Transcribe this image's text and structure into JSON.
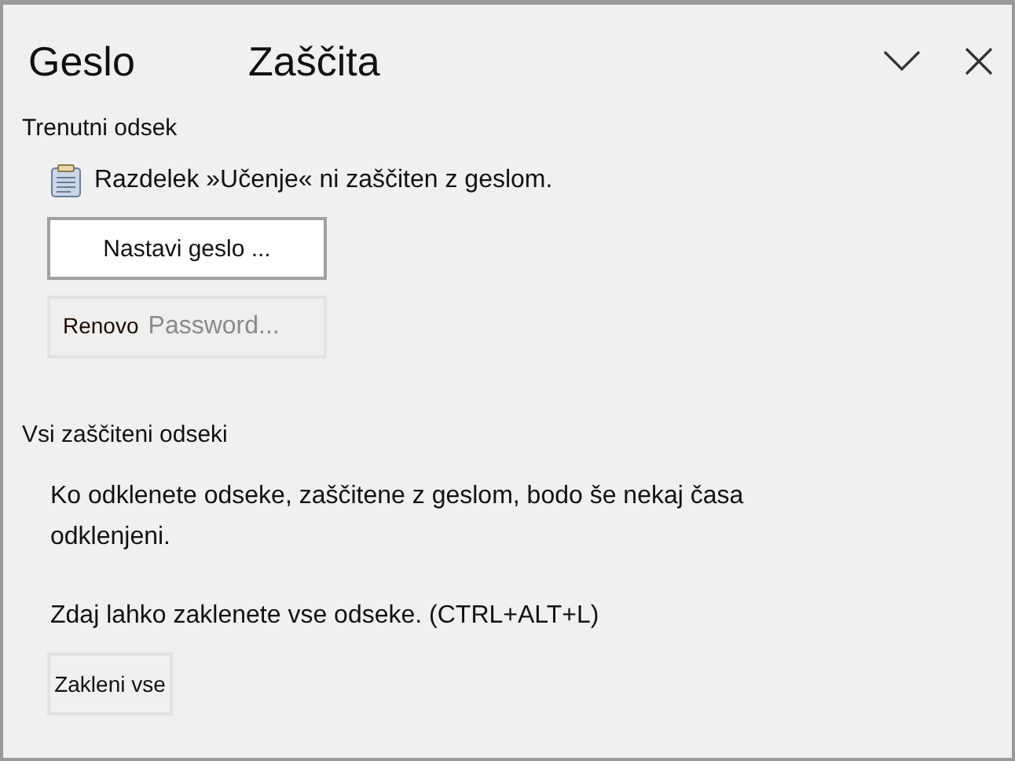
{
  "panel": {
    "title_parts": [
      "Geslo",
      "Zaščita"
    ]
  },
  "current_section": {
    "heading": "Trenutni odsek",
    "status": "Razdelek »Učenje« ni zaščiten z geslom.",
    "buttons": [
      {
        "label": "Nastavi geslo ...",
        "disabled": false
      },
      {
        "label": "Renovo",
        "overlay_label": "Password...",
        "disabled": true
      }
    ]
  },
  "all_sections": {
    "heading": "Vsi zaščiteni odseki",
    "info": "Ko odklenete odseke, zaščitene z geslom, bodo še nekaj časa odklenjeni.",
    "hint": "Zdaj lahko zaklenete vse odseke. (CTRL+ALT+L)",
    "button": {
      "label": "Zakleni vse",
      "disabled": false
    }
  }
}
